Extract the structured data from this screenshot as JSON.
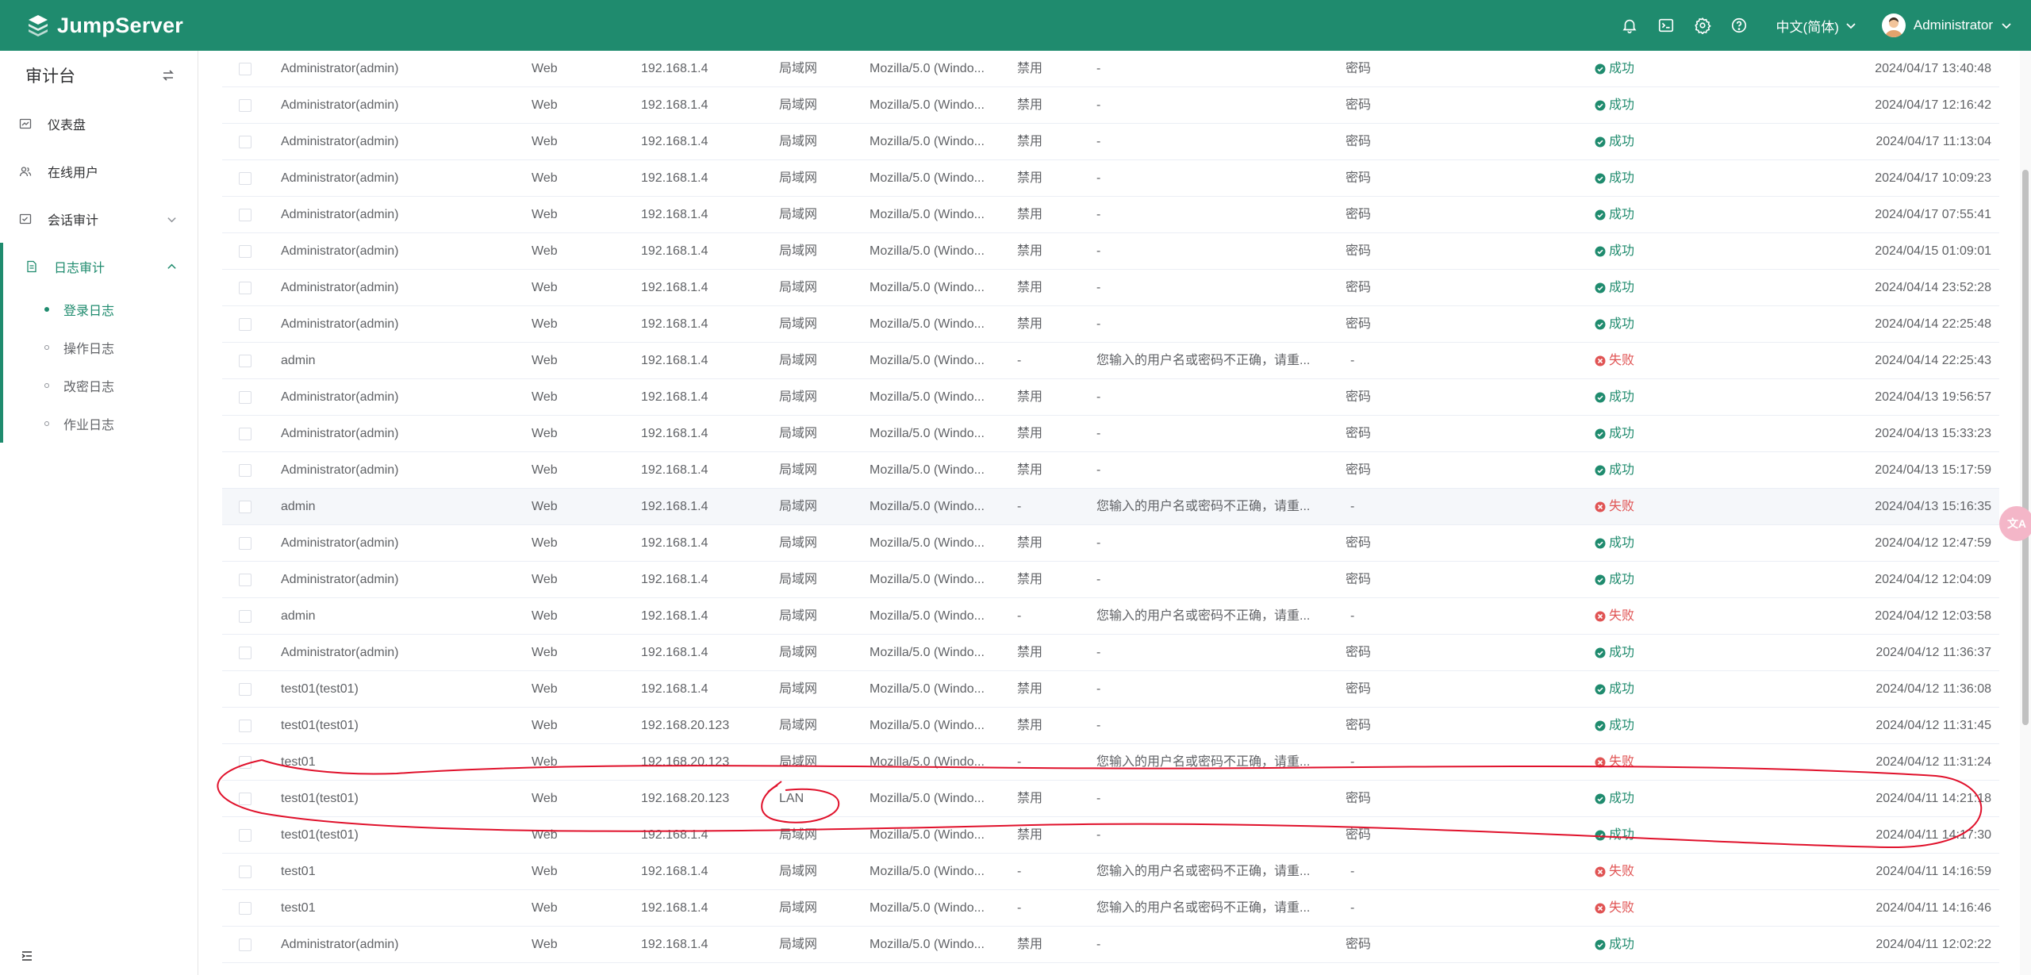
{
  "header": {
    "brand": "JumpServer",
    "language": "中文(简体)",
    "user": "Administrator",
    "icons": [
      "bell-icon",
      "terminal-icon",
      "settings-icon",
      "help-icon"
    ]
  },
  "sidebar": {
    "title": "审计台",
    "items": [
      {
        "label": "仪表盘",
        "icon": "dashboard-icon"
      },
      {
        "label": "在线用户",
        "icon": "users-icon"
      },
      {
        "label": "会话审计",
        "icon": "session-icon"
      }
    ],
    "group": {
      "label": "日志审计",
      "children": [
        {
          "label": "登录日志",
          "active": true
        },
        {
          "label": "操作日志",
          "active": false
        },
        {
          "label": "改密日志",
          "active": false
        },
        {
          "label": "作业日志",
          "active": false
        }
      ]
    }
  },
  "colors": {
    "brand": "#1f8b6e",
    "success": "#1f8b6e",
    "failure": "#e05353",
    "annotation": "#e0112b"
  },
  "float_button": {
    "label": "文A"
  },
  "table": {
    "rows": [
      {
        "user": "Administrator(admin)",
        "type": "Web",
        "ip": "192.168.1.4",
        "city": "局域网",
        "ua": "Mozilla/5.0 (Windo...",
        "mfa": "禁用",
        "reason": "-",
        "backend": "密码",
        "status": "成功",
        "ok": true,
        "time": "2024/04/17 13:40:48"
      },
      {
        "user": "Administrator(admin)",
        "type": "Web",
        "ip": "192.168.1.4",
        "city": "局域网",
        "ua": "Mozilla/5.0 (Windo...",
        "mfa": "禁用",
        "reason": "-",
        "backend": "密码",
        "status": "成功",
        "ok": true,
        "time": "2024/04/17 12:16:42"
      },
      {
        "user": "Administrator(admin)",
        "type": "Web",
        "ip": "192.168.1.4",
        "city": "局域网",
        "ua": "Mozilla/5.0 (Windo...",
        "mfa": "禁用",
        "reason": "-",
        "backend": "密码",
        "status": "成功",
        "ok": true,
        "time": "2024/04/17 11:13:04"
      },
      {
        "user": "Administrator(admin)",
        "type": "Web",
        "ip": "192.168.1.4",
        "city": "局域网",
        "ua": "Mozilla/5.0 (Windo...",
        "mfa": "禁用",
        "reason": "-",
        "backend": "密码",
        "status": "成功",
        "ok": true,
        "time": "2024/04/17 10:09:23"
      },
      {
        "user": "Administrator(admin)",
        "type": "Web",
        "ip": "192.168.1.4",
        "city": "局域网",
        "ua": "Mozilla/5.0 (Windo...",
        "mfa": "禁用",
        "reason": "-",
        "backend": "密码",
        "status": "成功",
        "ok": true,
        "time": "2024/04/17 07:55:41"
      },
      {
        "user": "Administrator(admin)",
        "type": "Web",
        "ip": "192.168.1.4",
        "city": "局域网",
        "ua": "Mozilla/5.0 (Windo...",
        "mfa": "禁用",
        "reason": "-",
        "backend": "密码",
        "status": "成功",
        "ok": true,
        "time": "2024/04/15 01:09:01"
      },
      {
        "user": "Administrator(admin)",
        "type": "Web",
        "ip": "192.168.1.4",
        "city": "局域网",
        "ua": "Mozilla/5.0 (Windo...",
        "mfa": "禁用",
        "reason": "-",
        "backend": "密码",
        "status": "成功",
        "ok": true,
        "time": "2024/04/14 23:52:28"
      },
      {
        "user": "Administrator(admin)",
        "type": "Web",
        "ip": "192.168.1.4",
        "city": "局域网",
        "ua": "Mozilla/5.0 (Windo...",
        "mfa": "禁用",
        "reason": "-",
        "backend": "密码",
        "status": "成功",
        "ok": true,
        "time": "2024/04/14 22:25:48"
      },
      {
        "user": "admin",
        "type": "Web",
        "ip": "192.168.1.4",
        "city": "局域网",
        "ua": "Mozilla/5.0 (Windo...",
        "mfa": "-",
        "reason": "您输入的用户名或密码不正确，请重...",
        "backend": "-",
        "status": "失败",
        "ok": false,
        "time": "2024/04/14 22:25:43"
      },
      {
        "user": "Administrator(admin)",
        "type": "Web",
        "ip": "192.168.1.4",
        "city": "局域网",
        "ua": "Mozilla/5.0 (Windo...",
        "mfa": "禁用",
        "reason": "-",
        "backend": "密码",
        "status": "成功",
        "ok": true,
        "time": "2024/04/13 19:56:57"
      },
      {
        "user": "Administrator(admin)",
        "type": "Web",
        "ip": "192.168.1.4",
        "city": "局域网",
        "ua": "Mozilla/5.0 (Windo...",
        "mfa": "禁用",
        "reason": "-",
        "backend": "密码",
        "status": "成功",
        "ok": true,
        "time": "2024/04/13 15:33:23"
      },
      {
        "user": "Administrator(admin)",
        "type": "Web",
        "ip": "192.168.1.4",
        "city": "局域网",
        "ua": "Mozilla/5.0 (Windo...",
        "mfa": "禁用",
        "reason": "-",
        "backend": "密码",
        "status": "成功",
        "ok": true,
        "time": "2024/04/13 15:17:59"
      },
      {
        "user": "admin",
        "type": "Web",
        "ip": "192.168.1.4",
        "city": "局域网",
        "ua": "Mozilla/5.0 (Windo...",
        "mfa": "-",
        "reason": "您输入的用户名或密码不正确，请重...",
        "backend": "-",
        "status": "失败",
        "ok": false,
        "time": "2024/04/13 15:16:35",
        "hl": true
      },
      {
        "user": "Administrator(admin)",
        "type": "Web",
        "ip": "192.168.1.4",
        "city": "局域网",
        "ua": "Mozilla/5.0 (Windo...",
        "mfa": "禁用",
        "reason": "-",
        "backend": "密码",
        "status": "成功",
        "ok": true,
        "time": "2024/04/12 12:47:59"
      },
      {
        "user": "Administrator(admin)",
        "type": "Web",
        "ip": "192.168.1.4",
        "city": "局域网",
        "ua": "Mozilla/5.0 (Windo...",
        "mfa": "禁用",
        "reason": "-",
        "backend": "密码",
        "status": "成功",
        "ok": true,
        "time": "2024/04/12 12:04:09"
      },
      {
        "user": "admin",
        "type": "Web",
        "ip": "192.168.1.4",
        "city": "局域网",
        "ua": "Mozilla/5.0 (Windo...",
        "mfa": "-",
        "reason": "您输入的用户名或密码不正确，请重...",
        "backend": "-",
        "status": "失败",
        "ok": false,
        "time": "2024/04/12 12:03:58"
      },
      {
        "user": "Administrator(admin)",
        "type": "Web",
        "ip": "192.168.1.4",
        "city": "局域网",
        "ua": "Mozilla/5.0 (Windo...",
        "mfa": "禁用",
        "reason": "-",
        "backend": "密码",
        "status": "成功",
        "ok": true,
        "time": "2024/04/12 11:36:37"
      },
      {
        "user": "test01(test01)",
        "type": "Web",
        "ip": "192.168.1.4",
        "city": "局域网",
        "ua": "Mozilla/5.0 (Windo...",
        "mfa": "禁用",
        "reason": "-",
        "backend": "密码",
        "status": "成功",
        "ok": true,
        "time": "2024/04/12 11:36:08"
      },
      {
        "user": "test01(test01)",
        "type": "Web",
        "ip": "192.168.20.123",
        "city": "局域网",
        "ua": "Mozilla/5.0 (Windo...",
        "mfa": "禁用",
        "reason": "-",
        "backend": "密码",
        "status": "成功",
        "ok": true,
        "time": "2024/04/12 11:31:45"
      },
      {
        "user": "test01",
        "type": "Web",
        "ip": "192.168.20.123",
        "city": "局域网",
        "ua": "Mozilla/5.0 (Windo...",
        "mfa": "-",
        "reason": "您输入的用户名或密码不正确，请重...",
        "backend": "-",
        "status": "失败",
        "ok": false,
        "time": "2024/04/12 11:31:24"
      },
      {
        "user": "test01(test01)",
        "type": "Web",
        "ip": "192.168.20.123",
        "city": "LAN",
        "ua": "Mozilla/5.0 (Windo...",
        "mfa": "禁用",
        "reason": "-",
        "backend": "密码",
        "status": "成功",
        "ok": true,
        "time": "2024/04/11 14:21:18"
      },
      {
        "user": "test01(test01)",
        "type": "Web",
        "ip": "192.168.1.4",
        "city": "局域网",
        "ua": "Mozilla/5.0 (Windo...",
        "mfa": "禁用",
        "reason": "-",
        "backend": "密码",
        "status": "成功",
        "ok": true,
        "time": "2024/04/11 14:17:30"
      },
      {
        "user": "test01",
        "type": "Web",
        "ip": "192.168.1.4",
        "city": "局域网",
        "ua": "Mozilla/5.0 (Windo...",
        "mfa": "-",
        "reason": "您输入的用户名或密码不正确，请重...",
        "backend": "-",
        "status": "失败",
        "ok": false,
        "time": "2024/04/11 14:16:59"
      },
      {
        "user": "test01",
        "type": "Web",
        "ip": "192.168.1.4",
        "city": "局域网",
        "ua": "Mozilla/5.0 (Windo...",
        "mfa": "-",
        "reason": "您输入的用户名或密码不正确，请重...",
        "backend": "-",
        "status": "失败",
        "ok": false,
        "time": "2024/04/11 14:16:46"
      },
      {
        "user": "Administrator(admin)",
        "type": "Web",
        "ip": "192.168.1.4",
        "city": "局域网",
        "ua": "Mozilla/5.0 (Windo...",
        "mfa": "禁用",
        "reason": "-",
        "backend": "密码",
        "status": "成功",
        "ok": true,
        "time": "2024/04/11 12:02:22"
      }
    ]
  }
}
